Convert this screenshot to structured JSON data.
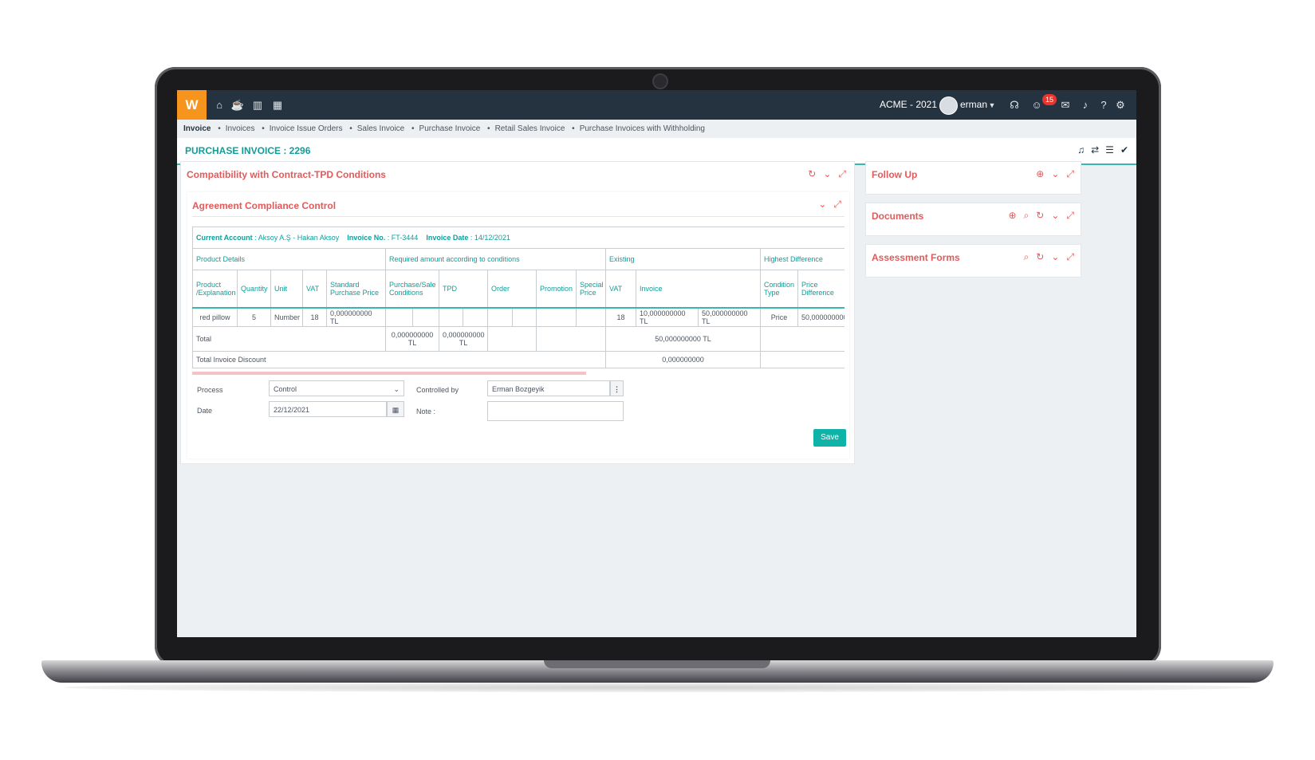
{
  "topbar": {
    "logo_text": "W",
    "company": "ACME - 2021",
    "username": "erman",
    "notification_count": "15",
    "icons": [
      "home-icon",
      "coffee-icon",
      "chart-icon",
      "calendar-icon",
      "headset-icon",
      "emoji-icon",
      "chat-icon",
      "bell-icon",
      "help-icon",
      "gear-icon"
    ]
  },
  "breadcrumb": {
    "items": [
      "Invoice",
      "Invoices",
      "Invoice Issue Orders",
      "Sales Invoice",
      "Purchase Invoice",
      "Retail Sales Invoice",
      "Purchase Invoices with Withholding"
    ]
  },
  "page": {
    "title": "PURCHASE INVOICE : 2296"
  },
  "main_panel": {
    "title": "Compatibility with Contract-TPD Conditions",
    "sub_panel_title": "Agreement Compliance Control",
    "info": {
      "account_label": "Current Account",
      "account_value": "Aksoy A.Ş - Hakan Aksoy",
      "invoice_no_label": "Invoice No.",
      "invoice_no_value": "FT-3444",
      "invoice_date_label": "Invoice Date",
      "invoice_date_value": "14/12/2021"
    },
    "group_headers": [
      "Product Details",
      "Required amount according to conditions",
      "Existing",
      "Highest Difference"
    ],
    "column_headers": [
      "Product /Explanation",
      "Quantity",
      "Unit",
      "VAT",
      "Standard Purchase Price",
      "Purchase/Sale Conditions",
      "TPD",
      "Order",
      "Promotion",
      "Special Price",
      "VAT",
      "Invoice",
      "Condition Type",
      "Price Difference"
    ],
    "row": {
      "product": "red pillow",
      "quantity": "5",
      "unit": "Number",
      "vat": "18",
      "standard_price": "0,000000000 TL",
      "existing_vat": "18",
      "invoice_a": "10,000000000 TL",
      "invoice_b": "50,000000000 TL",
      "condition_type": "Price",
      "price_difference": "50,000000000"
    },
    "total": {
      "label": "Total",
      "purchase_sale": "0,000000000 TL",
      "tpd": "0,000000000 TL",
      "existing": "50,000000000 TL"
    },
    "discount": {
      "label": "Total Invoice Discount",
      "value": "0,000000000"
    },
    "form": {
      "process_label": "Process",
      "process_value": "Control",
      "date_label": "Date",
      "date_value": "22/12/2021",
      "controlled_by_label": "Controlled by",
      "controlled_by_value": "Erman Bozgeyik",
      "note_label": "Note :",
      "save_label": "Save"
    }
  },
  "side_panels": [
    {
      "title": "Follow Up"
    },
    {
      "title": "Documents"
    },
    {
      "title": "Assessment Forms"
    }
  ],
  "colors": {
    "topbar": "#253340",
    "accent_orange": "#f7941d",
    "teal": "#0f9e9a",
    "panel_title_red": "#e4595a",
    "save_button": "#0fb3a8"
  }
}
